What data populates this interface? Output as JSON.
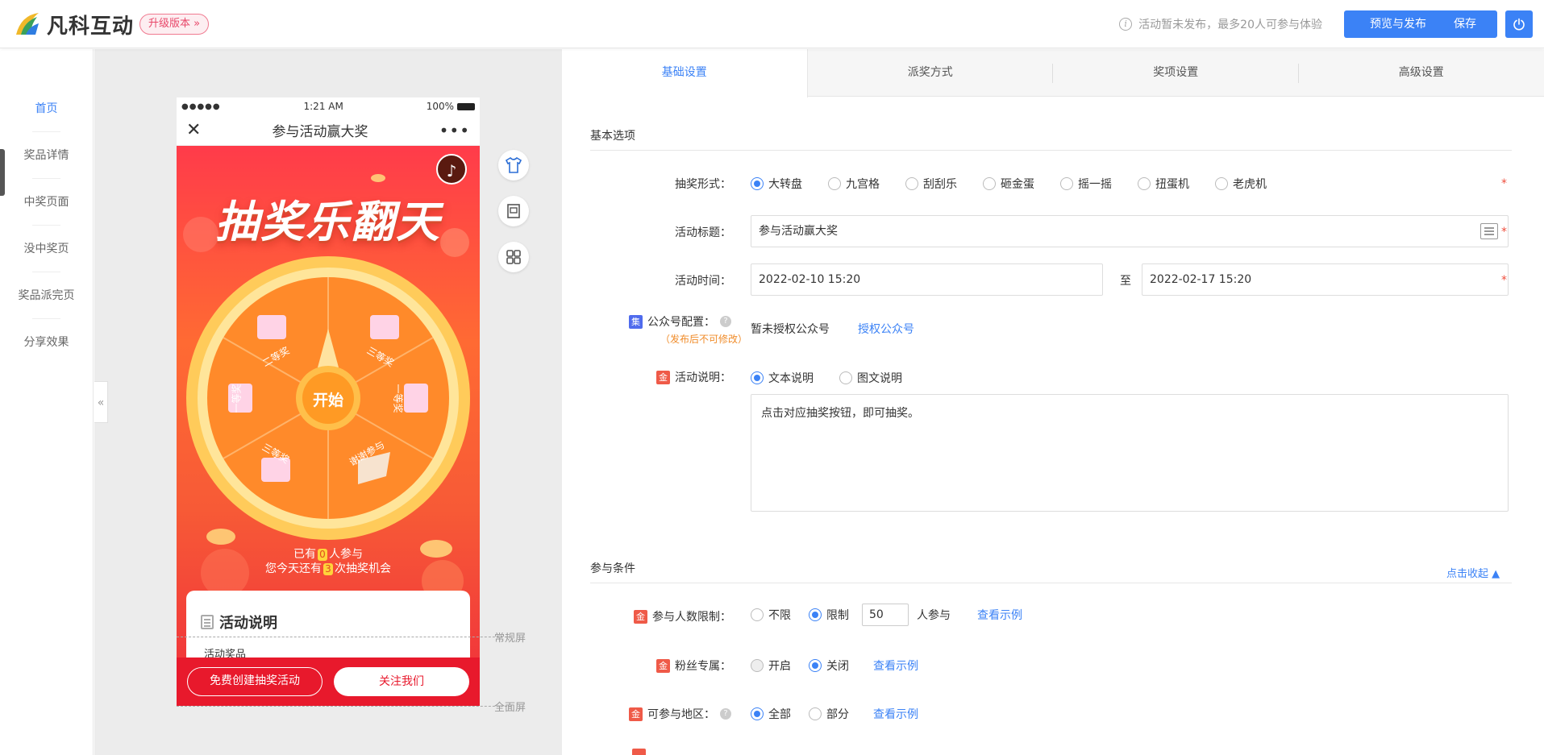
{
  "header": {
    "logo_text": "凡科互动",
    "upgrade_label": "升级版本 »",
    "status_text": "活动暂未发布，最多20人可参与体验",
    "preview_label": "预览与发布",
    "save_label": "保存",
    "brand_color": "#3b82f6"
  },
  "leftnav": {
    "items": [
      {
        "label": "首页"
      },
      {
        "label": "奖品详情"
      },
      {
        "label": "中奖页面"
      },
      {
        "label": "没中奖页"
      },
      {
        "label": "奖品派完页"
      },
      {
        "label": "分享效果"
      }
    ]
  },
  "phone": {
    "time": "1:21 AM",
    "battery": "100%",
    "title": "参与活动赢大奖",
    "headline": "抽奖乐翻天",
    "start_label": "开始",
    "prizes": [
      "二等奖",
      "三等奖",
      "一等奖",
      "谢谢参与",
      "三等奖",
      "一等奖"
    ],
    "participants_pre": "已有",
    "participants_count": "0",
    "participants_post": "人参与",
    "chances_pre": "您今天还有",
    "chances_count": "3",
    "chances_post": "次抽奖机会",
    "rules_title": "活动说明",
    "rules_sub": "活动奖品",
    "btn_create": "免费创建抽奖活动",
    "btn_follow": "关注我们",
    "guide_normal": "常规屏",
    "guide_full": "全面屏"
  },
  "panel": {
    "tabs": [
      {
        "label": "基础设置"
      },
      {
        "label": "派奖方式"
      },
      {
        "label": "奖项设置"
      },
      {
        "label": "高级设置"
      }
    ],
    "basic_section": "基本选项",
    "lottery_form": {
      "label": "抽奖形式：",
      "options": [
        "大转盘",
        "九宫格",
        "刮刮乐",
        "砸金蛋",
        "摇一摇",
        "扭蛋机",
        "老虎机"
      ],
      "selected": "大转盘"
    },
    "title_field": {
      "label": "活动标题：",
      "value": "参与活动赢大奖"
    },
    "time_field": {
      "label": "活动时间：",
      "start": "2022-02-10 15:20",
      "to": "至",
      "end": "2022-02-17 15:20"
    },
    "wechat": {
      "label": "公众号配置：",
      "badge": "集",
      "sub": "（发布后不可修改）",
      "status": "暂未授权公众号",
      "link": "授权公众号"
    },
    "desc": {
      "label": "活动说明：",
      "badge": "金",
      "options": [
        "文本说明",
        "图文说明"
      ],
      "selected": "文本说明",
      "text": "点击对应抽奖按钮，即可抽奖。"
    },
    "cond_section": "参与条件",
    "collapse_link": "点击收起",
    "limit": {
      "label": "参与人数限制：",
      "badge": "金",
      "options": [
        "不限",
        "限制"
      ],
      "selected": "限制",
      "value": "50",
      "suffix": "人参与",
      "example": "查看示例"
    },
    "fans": {
      "label": "粉丝专属：",
      "badge": "金",
      "options": [
        "开启",
        "关闭"
      ],
      "selected": "关闭",
      "example": "查看示例"
    },
    "region": {
      "label": "可参与地区：",
      "badge": "金",
      "options": [
        "全部",
        "部分"
      ],
      "selected": "全部",
      "example": "查看示例"
    },
    "required_mark": "*"
  }
}
